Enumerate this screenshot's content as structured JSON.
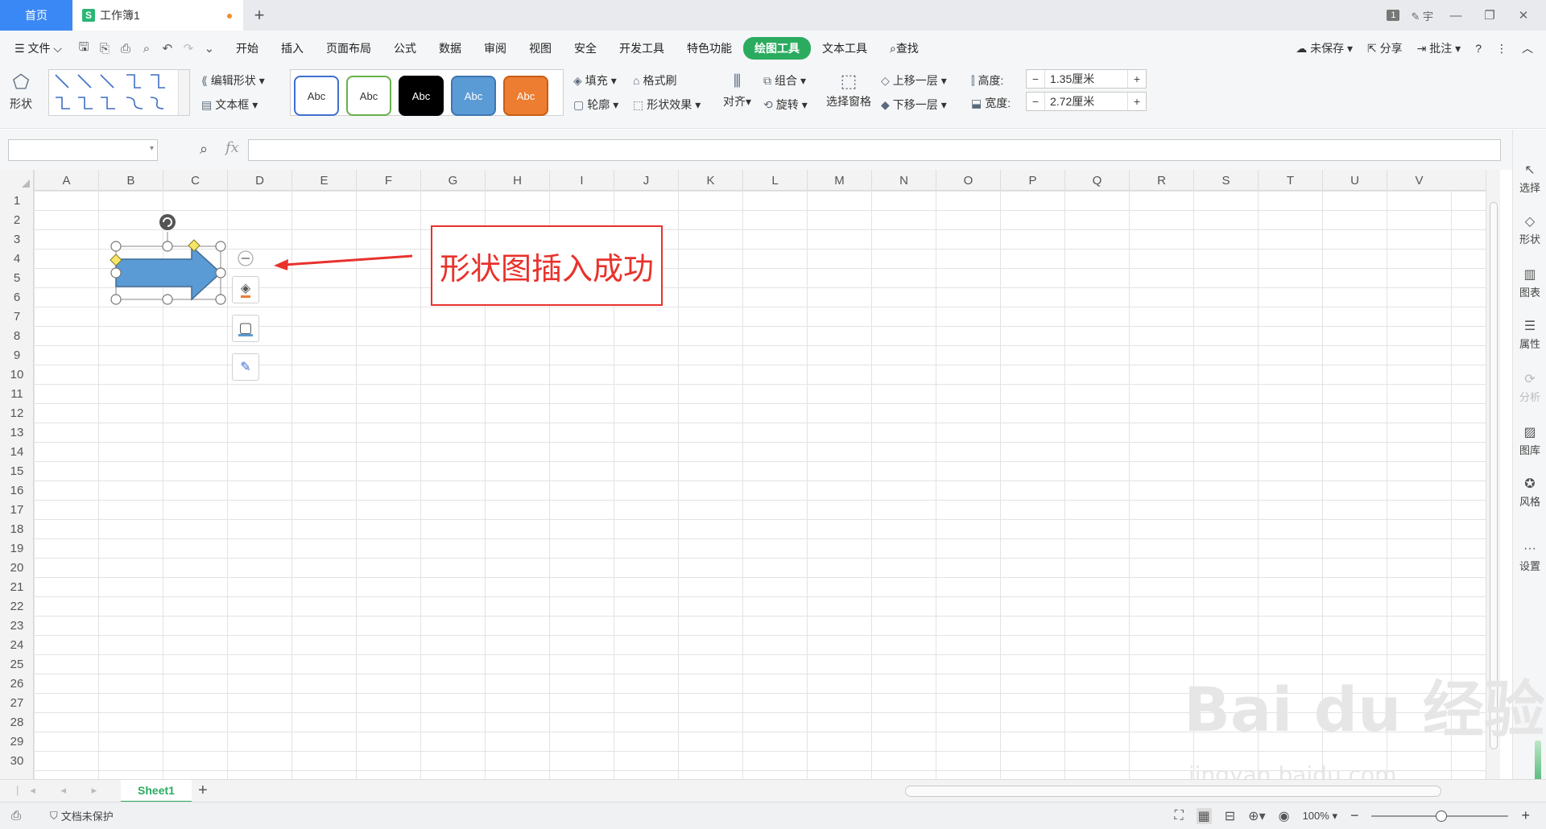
{
  "titlebar": {
    "home_tab": "首页",
    "doc_tab": "工作簿1",
    "doc_logo": "S",
    "new_tab": "+",
    "badge": "1",
    "user": "宇",
    "window_buttons": [
      "—",
      "❐",
      "✕"
    ]
  },
  "menubar": {
    "file": "文件",
    "items": [
      "开始",
      "插入",
      "页面布局",
      "公式",
      "数据",
      "审阅",
      "视图",
      "安全",
      "开发工具",
      "特色功能",
      "绘图工具",
      "文本工具"
    ],
    "active": "绘图工具",
    "search": "查找",
    "unsaved": "未保存",
    "share": "分享",
    "comment": "批注"
  },
  "ribbon": {
    "shape": "形状",
    "edit_shape": "编辑形状",
    "textbox": "文本框",
    "style_buttons": [
      {
        "label": "Abc",
        "bg": "#ffffff",
        "fg": "#333333",
        "border": "#3f6fd1"
      },
      {
        "label": "Abc",
        "bg": "#ffffff",
        "fg": "#333333",
        "border": "#69b04a"
      },
      {
        "label": "Abc",
        "bg": "#000000",
        "fg": "#ffffff",
        "border": "#000000"
      },
      {
        "label": "Abc",
        "bg": "#5b9bd5",
        "fg": "#ffffff",
        "border": "#3f75b3"
      },
      {
        "label": "Abc",
        "bg": "#ed7d31",
        "fg": "#ffffff",
        "border": "#c55e17"
      }
    ],
    "fill": "填充",
    "outline": "轮廓",
    "format_painter": "格式刷",
    "shape_effects": "形状效果",
    "align": "对齐",
    "group": "组合",
    "rotate": "旋转",
    "selection_pane": "选择窗格",
    "bring_forward": "上移一层",
    "send_backward": "下移一层",
    "height_label": "高度:",
    "height_value": "1.35厘米",
    "width_label": "宽度:",
    "width_value": "2.72厘米"
  },
  "formula": {
    "fx": "fx"
  },
  "grid": {
    "columns": [
      "A",
      "B",
      "C",
      "D",
      "E",
      "F",
      "G",
      "H",
      "I",
      "J",
      "K",
      "L",
      "M",
      "N",
      "O",
      "P",
      "Q",
      "R",
      "S",
      "T",
      "U",
      "V"
    ],
    "rows": [
      "1",
      "2",
      "3",
      "4",
      "5",
      "6",
      "7",
      "8",
      "9",
      "10",
      "11",
      "12",
      "13",
      "14",
      "15",
      "16",
      "17",
      "18",
      "19",
      "20",
      "21",
      "22",
      "23",
      "24",
      "25",
      "26",
      "27",
      "28",
      "29",
      "30"
    ]
  },
  "shape": {
    "fill_color": "#5b9bd5",
    "annotation": "形状图插入成功",
    "annotation_color": "#e8322c"
  },
  "sidepanel": {
    "items": [
      {
        "label": "选择",
        "icon": "cursor-icon",
        "glyph": "↖",
        "disabled": false
      },
      {
        "label": "形状",
        "icon": "shapes-icon",
        "glyph": "◇",
        "disabled": false
      },
      {
        "label": "图表",
        "icon": "chart-icon",
        "glyph": "▥",
        "disabled": false
      },
      {
        "label": "属性",
        "icon": "properties-icon",
        "glyph": "☰",
        "disabled": false
      },
      {
        "label": "分析",
        "icon": "analysis-icon",
        "glyph": "⟳",
        "disabled": true
      },
      {
        "label": "图库",
        "icon": "gallery-icon",
        "glyph": "▨",
        "disabled": false
      },
      {
        "label": "风格",
        "icon": "style-icon",
        "glyph": "✪",
        "disabled": false
      },
      {
        "label": "设置",
        "icon": "settings-icon",
        "glyph": "···",
        "disabled": false
      }
    ]
  },
  "sheets": {
    "tabs": [
      "Sheet1"
    ],
    "add": "+"
  },
  "status": {
    "protection": "文档未保护",
    "zoom": "100%"
  },
  "watermark": {
    "brand": "Bai du 经验",
    "url": "jingyan.baidu.com"
  }
}
